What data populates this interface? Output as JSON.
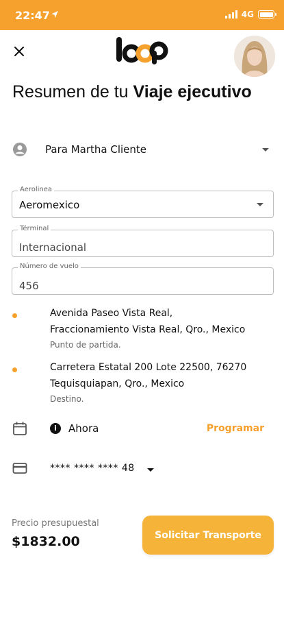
{
  "status_bar": {
    "time": "22:47",
    "network": "4G"
  },
  "brand": {
    "logo_text": "loop",
    "accent": "#f6a02d"
  },
  "title": {
    "regular": "Resumen de tu ",
    "bold": "Viaje ejecutivo"
  },
  "passenger": {
    "label": "Para Martha Cliente"
  },
  "fields": {
    "airline": {
      "label": "Aerolinea",
      "value": "Aeromexico"
    },
    "terminal": {
      "label": "Términal",
      "value": "Internacional"
    },
    "flight": {
      "label": "Número de vuelo",
      "value": "456"
    }
  },
  "origin": {
    "line1": "Avenida Paseo Vista Real,",
    "line2": "Fraccionamiento Vista Real, Qro., Mexico",
    "caption": "Punto de partida."
  },
  "destination": {
    "line1": "Carretera Estatal 200 Lote 22500, 76270",
    "line2": "Tequisquiapan, Qro., Mexico",
    "caption": "Destino."
  },
  "when": {
    "label": "Ahora",
    "schedule_label": "Programar"
  },
  "payment": {
    "card_label": "**** **** **** 48"
  },
  "price": {
    "caption": "Precio presupuestal",
    "value": "$1832.00"
  },
  "cta": {
    "label": "Solicitar Transporte"
  }
}
